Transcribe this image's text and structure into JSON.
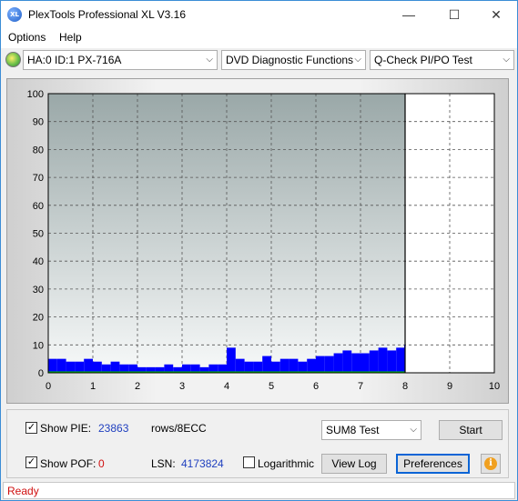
{
  "window": {
    "title": "PlexTools Professional XL V3.16",
    "icon_text": "XL"
  },
  "window_controls": {
    "minimize": "—",
    "maximize": "☐",
    "close": "✕"
  },
  "menu": {
    "options": "Options",
    "help": "Help"
  },
  "toolbar": {
    "drive": "HA:0 ID:1  PX-716A",
    "function": "DVD Diagnostic Functions",
    "test": "Q-Check PI/PO Test"
  },
  "controls": {
    "show_pie_label": "Show PIE:",
    "pie_value": "23863",
    "pie_unit": "rows/8ECC",
    "show_pof_label": "Show POF:",
    "pof_value": "0",
    "lsn_label": "LSN:",
    "lsn_value": "4173824",
    "logarithmic_label": "Logarithmic",
    "test_select": "SUM8 Test",
    "start_button": "Start",
    "view_log_button": "View Log",
    "preferences_button": "Preferences",
    "info_icon_text": "i",
    "show_pie_checked": true,
    "show_pof_checked": true,
    "logarithmic_checked": false
  },
  "status": {
    "text": "Ready"
  },
  "chart_data": {
    "type": "bar",
    "xlim": [
      0,
      10
    ],
    "ylim": [
      0,
      100
    ],
    "x_ticks": [
      "0",
      "1",
      "2",
      "3",
      "4",
      "5",
      "6",
      "7",
      "8",
      "9",
      "10"
    ],
    "y_ticks": [
      "0",
      "10",
      "20",
      "30",
      "40",
      "50",
      "60",
      "70",
      "80",
      "90",
      "100"
    ],
    "grid": true,
    "scan_end_x": 8.0,
    "series": [
      {
        "color": "#0000ff",
        "x": [
          0.0,
          0.2,
          0.4,
          0.6,
          0.8,
          1.0,
          1.2,
          1.4,
          1.6,
          1.8,
          2.0,
          2.2,
          2.4,
          2.6,
          2.8,
          3.0,
          3.2,
          3.4,
          3.6,
          3.8,
          4.0,
          4.2,
          4.4,
          4.6,
          4.8,
          5.0,
          5.2,
          5.4,
          5.6,
          5.8,
          6.0,
          6.2,
          6.4,
          6.6,
          6.8,
          7.0,
          7.2,
          7.4,
          7.6,
          7.8,
          7.98
        ],
        "values": [
          5,
          5,
          4,
          4,
          5,
          4,
          3,
          4,
          3,
          3,
          2,
          2,
          2,
          3,
          2,
          3,
          3,
          2,
          3,
          3,
          9,
          5,
          4,
          4,
          6,
          4,
          5,
          5,
          4,
          5,
          6,
          6,
          7,
          8,
          7,
          7,
          8,
          9,
          8,
          9,
          10
        ]
      }
    ],
    "baseline_color": "#00cc00"
  }
}
